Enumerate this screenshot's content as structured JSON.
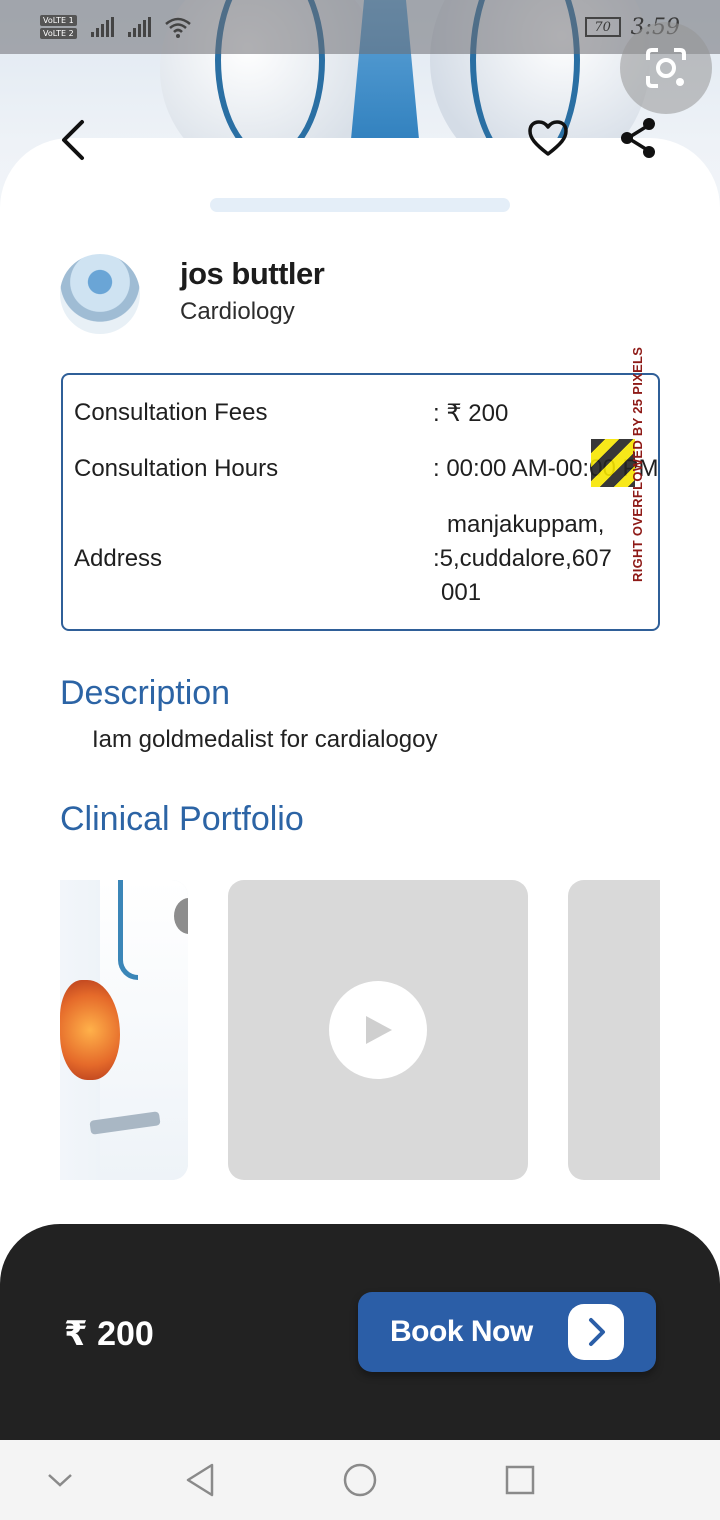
{
  "status_bar": {
    "volte_1": "VoLTE 1",
    "volte_2": "VoLTE 2",
    "battery": "70",
    "time": "3:59"
  },
  "doctor": {
    "name": "jos buttler",
    "specialty": "Cardiology"
  },
  "details": {
    "fees_label": "Consultation Fees",
    "fees_value": ": ₹ 200",
    "hours_label": "Consultation Hours",
    "hours_value": ": 00:00 AM-00:00 PM",
    "address_label": "Address",
    "address_line1": "manjakuppam,",
    "address_line2": ":5,cuddalore,607",
    "address_line3": "001",
    "overflow_warning": "RIGHT OVERFLOWED BY 25 PIXELS"
  },
  "description": {
    "title": "Description",
    "text": "Iam goldmedalist for cardialogoy"
  },
  "portfolio": {
    "title": "Clinical Portfolio"
  },
  "booking": {
    "price": "₹ 200",
    "button_label": "Book Now"
  },
  "colors": {
    "accent": "#2c64a5",
    "button": "#2b5ea7",
    "bottom_bar": "#222222"
  },
  "icons": [
    "back-arrow-icon",
    "heart-icon",
    "share-icon",
    "lens-icon",
    "play-icon",
    "chevron-right-icon",
    "nav-down-icon",
    "nav-back-icon",
    "nav-home-icon",
    "nav-recents-icon"
  ]
}
